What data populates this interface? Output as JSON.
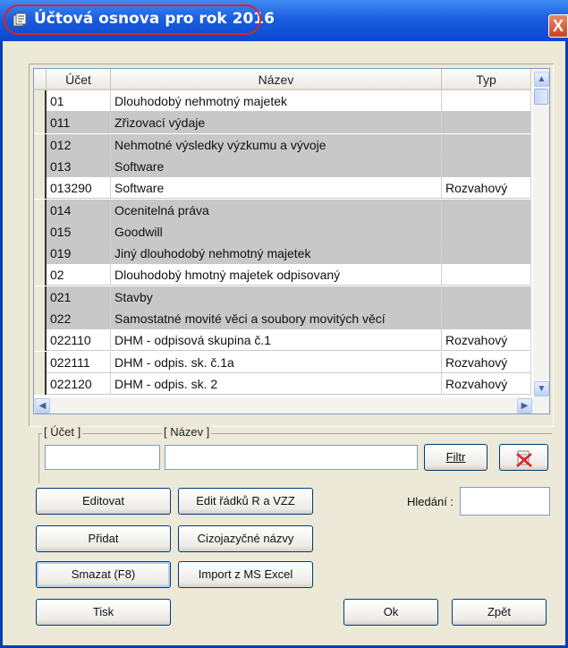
{
  "window": {
    "title": "Účtová osnova pro rok 2016",
    "close_label": "X"
  },
  "grid": {
    "columns": [
      "Účet",
      "Název",
      "Typ"
    ],
    "rows": [
      {
        "ucet": "01",
        "nazev": "Dlouhodobý nehmotný majetek",
        "typ": "",
        "shade": "white"
      },
      {
        "ucet": "011",
        "nazev": "Zřizovací výdaje",
        "typ": "",
        "shade": "grey"
      },
      {
        "ucet": "012",
        "nazev": "Nehmotné výsledky výzkumu a vývoje",
        "typ": "",
        "shade": "grey"
      },
      {
        "ucet": "013",
        "nazev": "Software",
        "typ": "",
        "shade": "grey"
      },
      {
        "ucet": "013290",
        "nazev": "Software",
        "typ": "Rozvahový",
        "shade": "white"
      },
      {
        "ucet": "014",
        "nazev": "Ocenitelná práva",
        "typ": "",
        "shade": "grey"
      },
      {
        "ucet": "015",
        "nazev": "Goodwill",
        "typ": "",
        "shade": "grey"
      },
      {
        "ucet": "019",
        "nazev": "Jiný dlouhodobý nehmotný majetek",
        "typ": "",
        "shade": "grey"
      },
      {
        "ucet": "02",
        "nazev": "Dlouhodobý hmotný majetek odpisovaný",
        "typ": "",
        "shade": "white"
      },
      {
        "ucet": "021",
        "nazev": "Stavby",
        "typ": "",
        "shade": "grey"
      },
      {
        "ucet": "022",
        "nazev": "Samostatné movité věci a soubory movitých věcí",
        "typ": "",
        "shade": "grey"
      },
      {
        "ucet": "022110",
        "nazev": "DHM - odpisová skupina č.1",
        "typ": "Rozvahový",
        "shade": "white"
      },
      {
        "ucet": "022111",
        "nazev": "DHM - odpis. sk. č.1a",
        "typ": "Rozvahový",
        "shade": "white"
      },
      {
        "ucet": "022120",
        "nazev": "DHM - odpis. sk. 2",
        "typ": "Rozvahový",
        "shade": "white"
      }
    ]
  },
  "filter": {
    "ucet_label": "[ Účet ]",
    "nazev_label": "[ Název ]",
    "ucet_value": "",
    "nazev_value": "",
    "filtr_button": "Filtr"
  },
  "buttons": {
    "editovat": "Editovat",
    "edit_radku": "Edit řádků R a VZZ",
    "pridat": "Přidat",
    "cizojazycne": "Cizojazyčné názvy",
    "smazat": "Smazat (F8)",
    "import": "Import z MS Excel",
    "tisk": "Tisk",
    "ok": "Ok",
    "zpet": "Zpět"
  },
  "search": {
    "label": "Hledání :",
    "value": ""
  },
  "colors": {
    "title_bar": "#1b5ee0",
    "grey_row": "#c8c8c8",
    "highlight_ring": "#dd2222"
  }
}
